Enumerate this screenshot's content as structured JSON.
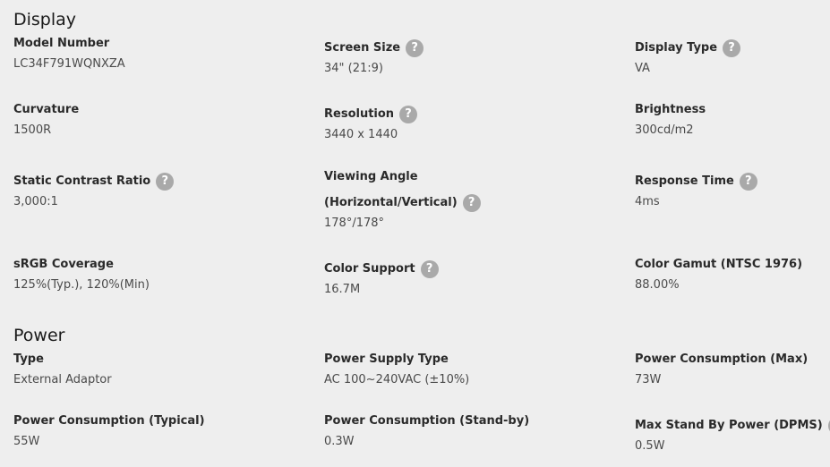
{
  "display": {
    "title": "Display",
    "specs": [
      {
        "label": "Model Number",
        "value": "LC34F791WQNXZA"
      },
      {
        "label": "Screen Size",
        "value": "34\" (21:9)"
      },
      {
        "label": "Display Type",
        "value": "VA"
      },
      {
        "label": "Curvature",
        "value": "1500R"
      },
      {
        "label": "Resolution",
        "value": "3440 x 1440"
      },
      {
        "label": "Brightness",
        "value": "300cd/m2"
      },
      {
        "label": "Static Contrast Ratio",
        "value": "3,000:1"
      },
      {
        "label_line1": "Viewing Angle",
        "label_line2": "(Horizontal/Vertical)",
        "value": "178°/178°"
      },
      {
        "label": "Response Time",
        "value": "4ms"
      },
      {
        "label": "sRGB Coverage",
        "value": "125%(Typ.), 120%(Min)"
      },
      {
        "label": "Color Support",
        "value": "16.7M"
      },
      {
        "label": "Color Gamut (NTSC 1976)",
        "value": "88.00%"
      }
    ]
  },
  "power": {
    "title": "Power",
    "specs": [
      {
        "label": "Type",
        "value": "External Adaptor"
      },
      {
        "label": "Power Supply Type",
        "value": "AC 100~240VAC (±10%)"
      },
      {
        "label": "Power Consumption (Max)",
        "value": "73W"
      },
      {
        "label": "Power Consumption (Typical)",
        "value": "55W"
      },
      {
        "label": "Power Consumption (Stand-by)",
        "value": "0.3W"
      },
      {
        "label": "Max Stand By Power (DPMS)",
        "value": "0.5W"
      }
    ]
  },
  "help_icon_glyph": "?"
}
